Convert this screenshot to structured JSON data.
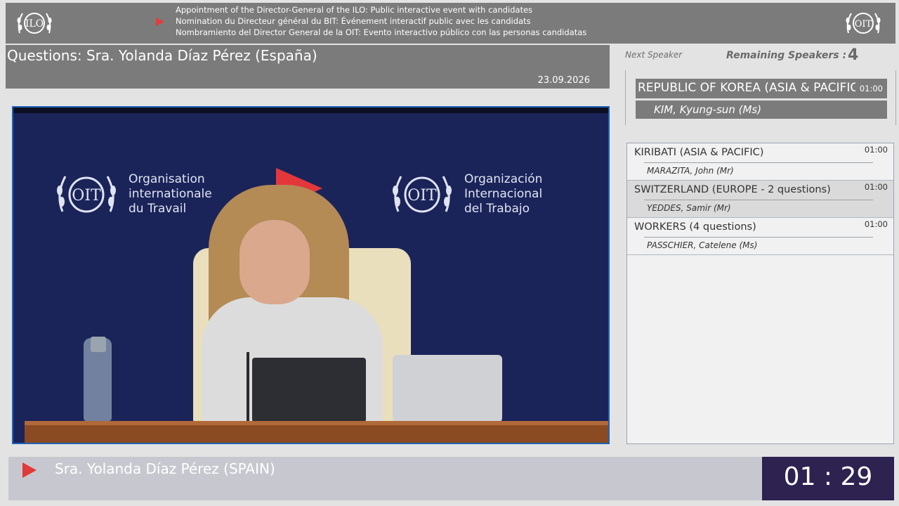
{
  "header": {
    "title_en": "Appointment of the Director-General of the ILO: Public interactive event with candidates",
    "title_fr": "Nomination du Directeur général du BIT: Événement interactif public avec les candidats",
    "title_es": "Nombramiento del Director General de la OIT: Evento interactivo público con las personas candidatas",
    "logo_left_text": "ILO",
    "logo_right_text": "OIT"
  },
  "session": {
    "questions_title": "Questions: Sra. Yolanda Díaz Pérez (España)",
    "date": "23.09.2026"
  },
  "panel": {
    "next_speaker_label": "Next Speaker",
    "remaining_label": "Remaining Speakers :",
    "remaining_count": "4"
  },
  "next_speaker": {
    "country": "REPUBLIC OF KOREA  (ASIA & PACIFIC)",
    "name": "KIM, Kyung-sun (Ms)",
    "time": "01:00"
  },
  "queue": [
    {
      "country": "KIRIBATI  (ASIA & PACIFIC)",
      "name": "MARAZITA, John (Mr)",
      "time": "01:00"
    },
    {
      "country": "SWITZERLAND  (EUROPE - 2 questions)",
      "name": "YEDDES, Samir (Mr)",
      "time": "01:00"
    },
    {
      "country": "WORKERS  (4 questions)",
      "name": "PASSCHIER, Catelene (Ms)",
      "time": "01:00"
    }
  ],
  "video": {
    "backdrop_left": {
      "line1": "Organisation",
      "line2": "internationale",
      "line3": "du Travail"
    },
    "backdrop_right": {
      "line1": "Organización",
      "line2": "Internacional",
      "line3": "del Trabajo"
    },
    "badge_text": "OIT"
  },
  "current": {
    "speaker": "Sra. Yolanda Díaz Pérez  (SPAIN)",
    "timer": "01 : 29"
  },
  "colors": {
    "header_gray": "#7b7b7b",
    "accent_red": "#e53b3b",
    "video_blue": "#1b2459",
    "timer_bg": "#2d2250"
  }
}
